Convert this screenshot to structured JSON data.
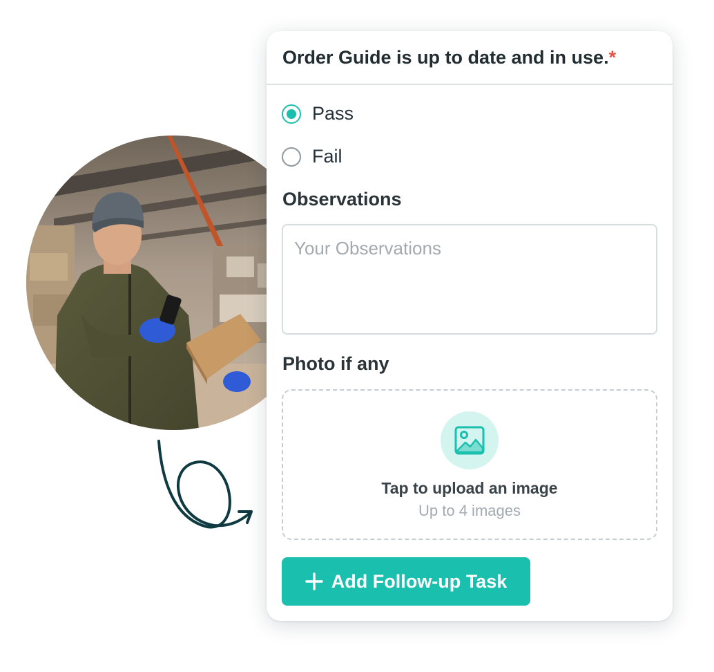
{
  "question": {
    "text": "Order Guide is up to date and in use.",
    "required_mark": "*"
  },
  "options": [
    {
      "label": "Pass",
      "selected": true
    },
    {
      "label": "Fail",
      "selected": false
    }
  ],
  "observations": {
    "label": "Observations",
    "placeholder": "Your Observations",
    "value": ""
  },
  "photo": {
    "label": "Photo if any",
    "upload_title": "Tap to upload an image",
    "upload_limit": "Up to 4 images",
    "icon": "image-icon"
  },
  "follow_up_button": {
    "label": "Add Follow-up Task",
    "icon": "plus-icon"
  },
  "colors": {
    "accent": "#1bbfae",
    "accent_light": "#d4f4ef",
    "required": "#e8544b",
    "arrow": "#0f3a42"
  }
}
